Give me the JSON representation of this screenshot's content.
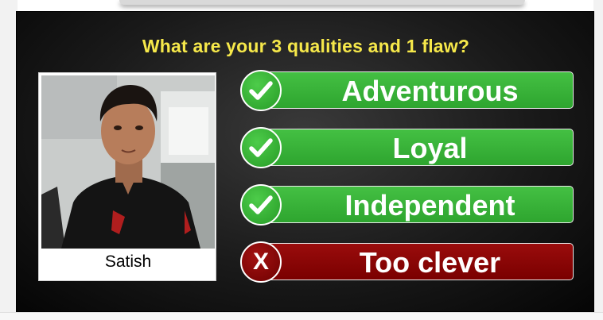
{
  "question": "What are your 3 qualities and 1 flaw?",
  "person": {
    "name": "Satish"
  },
  "traits": [
    {
      "label": "Adventurous",
      "kind": "quality",
      "icon": "checkmark-icon"
    },
    {
      "label": "Loyal",
      "kind": "quality",
      "icon": "checkmark-icon"
    },
    {
      "label": "Independent",
      "kind": "quality",
      "icon": "checkmark-icon"
    },
    {
      "label": "Too clever",
      "kind": "flaw",
      "icon": "x-icon"
    }
  ],
  "flaw_badge_symbol": "X",
  "colors": {
    "question": "#f6e84a",
    "quality": "#3aae38",
    "flaw": "#8b0404",
    "background": "#111111"
  }
}
